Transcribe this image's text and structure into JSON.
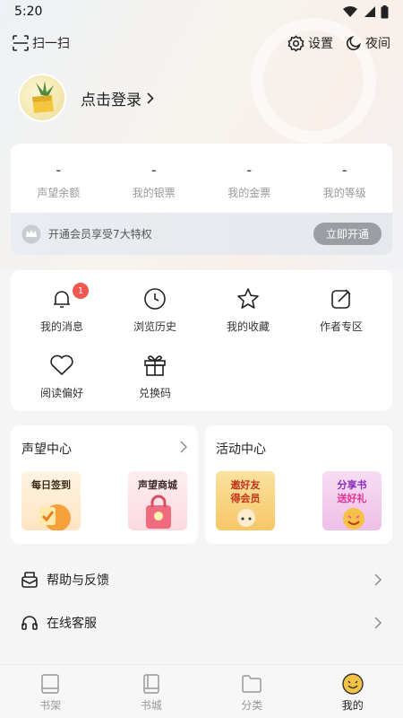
{
  "status_bar": {
    "time": "5:20"
  },
  "top_bar": {
    "scan_label": "扫一扫",
    "settings_label": "设置",
    "night_label": "夜间"
  },
  "profile": {
    "login_label": "点击登录"
  },
  "wallet": {
    "stats": [
      {
        "value": "-",
        "label": "声望余额"
      },
      {
        "value": "-",
        "label": "我的银票"
      },
      {
        "value": "-",
        "label": "我的金票"
      },
      {
        "value": "-",
        "label": "我的等级"
      }
    ],
    "vip_text": "开通会员享受7大特权",
    "vip_button": "立即开通"
  },
  "menu": {
    "items": [
      {
        "label": "我的消息",
        "icon": "bell-icon",
        "badge": "1"
      },
      {
        "label": "浏览历史",
        "icon": "clock-icon"
      },
      {
        "label": "我的收藏",
        "icon": "star-icon"
      },
      {
        "label": "作者专区",
        "icon": "edit-icon"
      },
      {
        "label": "阅读偏好",
        "icon": "heart-icon"
      },
      {
        "label": "兑换码",
        "icon": "gift-icon"
      }
    ]
  },
  "reputation_center": {
    "title": "声望中心",
    "tiles": [
      {
        "text": "每日签到",
        "color": "#f6a13a"
      },
      {
        "text": "声望商城",
        "color": "#f06b7e"
      }
    ]
  },
  "activity_center": {
    "title": "活动中心",
    "tiles": [
      {
        "text": "邀好友",
        "sub": "得会员",
        "color": "#f2c24a"
      },
      {
        "text": "分享书",
        "sub": "送好礼",
        "color": "#e55aa9"
      }
    ]
  },
  "list": [
    {
      "label": "帮助与反馈",
      "icon": "feedback-icon"
    },
    {
      "label": "在线客服",
      "icon": "headset-icon"
    }
  ],
  "tabbar": {
    "tabs": [
      {
        "label": "书架",
        "icon": "bookshelf-icon"
      },
      {
        "label": "书城",
        "icon": "bookstore-icon"
      },
      {
        "label": "分类",
        "icon": "folder-icon"
      },
      {
        "label": "我的",
        "icon": "smile-icon",
        "active": true
      }
    ]
  },
  "colors": {
    "badge": "#f0574e",
    "accent": "#f6c245",
    "vip_button": "#9a9da2"
  }
}
